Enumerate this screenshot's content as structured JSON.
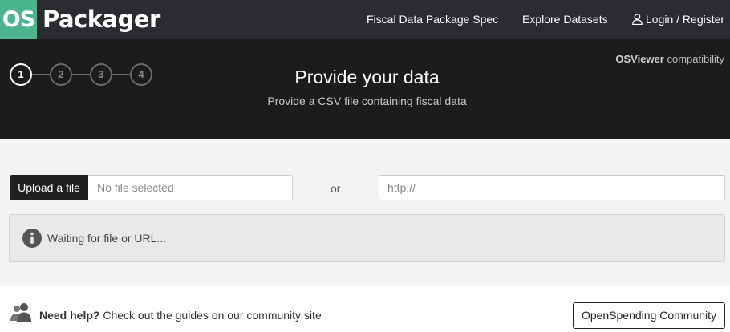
{
  "brand": {
    "logo_mark": "OS",
    "name": "Packager",
    "logo_color": "#4db58e"
  },
  "nav": {
    "spec_label": "Fiscal Data Package Spec",
    "explore_label": "Explore Datasets",
    "login_label": "Login / Register",
    "login_icon": "user-icon"
  },
  "header": {
    "steps": [
      "1",
      "2",
      "3",
      "4"
    ],
    "active_step": 1,
    "title": "Provide your data",
    "subtitle": "Provide a CSV file containing fiscal data",
    "compat_product": "OSViewer",
    "compat_suffix": "compatibility"
  },
  "upload": {
    "button_label": "Upload a file",
    "file_status": "No file selected",
    "or_label": "or",
    "url_placeholder": "http://"
  },
  "status": {
    "icon": "info-icon",
    "message": "Waiting for file or URL..."
  },
  "footer": {
    "help_icon": "users-icon",
    "help_bold": "Need help?",
    "help_text": "Check out the guides on our community site",
    "community_button": "OpenSpending Community"
  }
}
